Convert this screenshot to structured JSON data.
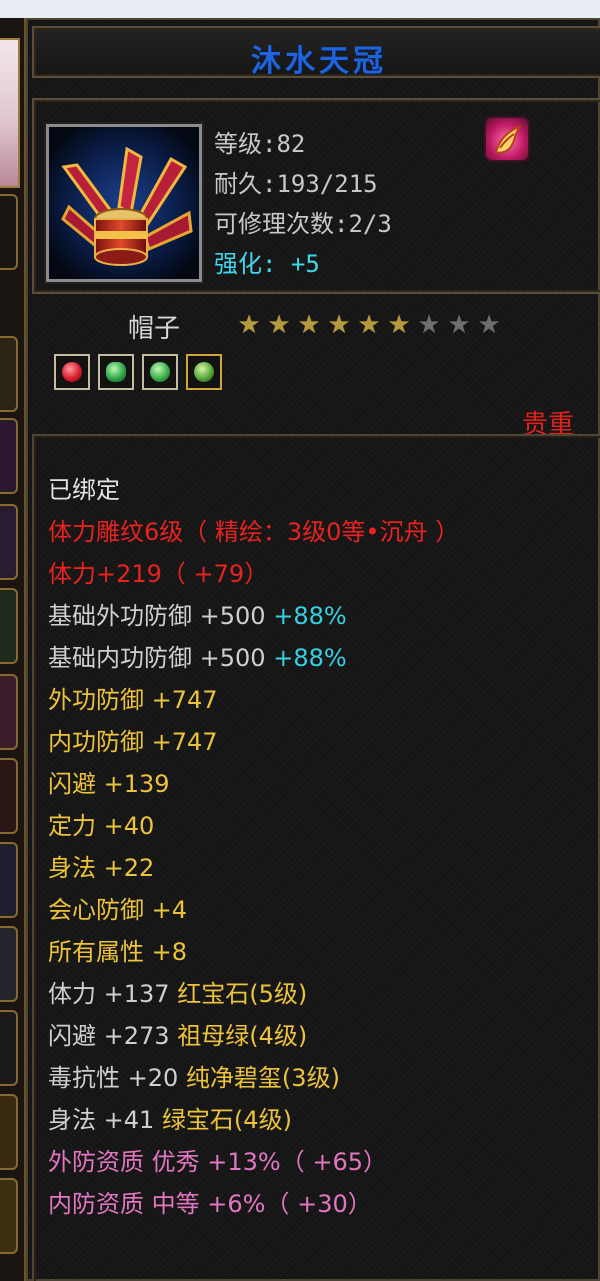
{
  "item": {
    "name": "沐水天冠",
    "level_text": "等级:82",
    "durability_text": "耐久:193/215",
    "repair_text": "可修理次数:2/3",
    "enhance_label": "强化:",
    "enhance_value": "+5",
    "type": "帽子",
    "rarity": "贵重",
    "stars_filled": 6,
    "stars_total": 9
  },
  "icons": {
    "item_icon": "winged-hat-icon",
    "corner_icon": "flame-feather-icon",
    "gem_icons": [
      "red-gem-icon",
      "green-gem-icon",
      "green-gem-icon",
      "green-gem-icon"
    ]
  },
  "lines": {
    "bound": "已绑定",
    "carve": "体力雕纹6级（ 精绘：3级0等•沉舟 ）",
    "stamina_bonus": "体力+219（ +79）",
    "base_outer_defense": "基础外功防御",
    "base_outer_defense_value": "+500",
    "base_outer_defense_pct": "+88%",
    "base_inner_defense": "基础内功防御",
    "base_inner_defense_value": "+500",
    "base_inner_defense_pct": "+88%",
    "outer_defense": "外功防御",
    "outer_defense_value": "+747",
    "inner_defense": "内功防御",
    "inner_defense_value": "+747",
    "dodge": "闪避",
    "dodge_value": "+139",
    "stability": "定力",
    "stability_value": "+40",
    "agility": "身法",
    "agility_value": "+22",
    "crit_defense": "会心防御",
    "crit_defense_value": "+4",
    "all_attrs": "所有属性",
    "all_attrs_value": "+8",
    "gem1_stat": "体力",
    "gem1_value": "+137",
    "gem1_name": "红宝石(5级)",
    "gem2_stat": "闪避",
    "gem2_value": "+273",
    "gem2_name": "祖母绿(4级)",
    "gem3_stat": "毒抗性",
    "gem3_value": "+20",
    "gem3_name": "纯净碧玺(3级)",
    "gem4_stat": "身法",
    "gem4_value": "+41",
    "gem4_name": "绿宝石(4级)",
    "outer_quality": "外防资质",
    "outer_quality_grade": "优秀",
    "outer_quality_value": "+13%（ +65）",
    "inner_quality": "内防资质",
    "inner_quality_grade": "中等",
    "inner_quality_value": "+6%（ +30）"
  },
  "colors": {
    "title": "#1f64dc",
    "red": "#e8231f",
    "cyan": "#36d1e3",
    "yellow": "#ecc33b",
    "pink": "#e276c1"
  }
}
